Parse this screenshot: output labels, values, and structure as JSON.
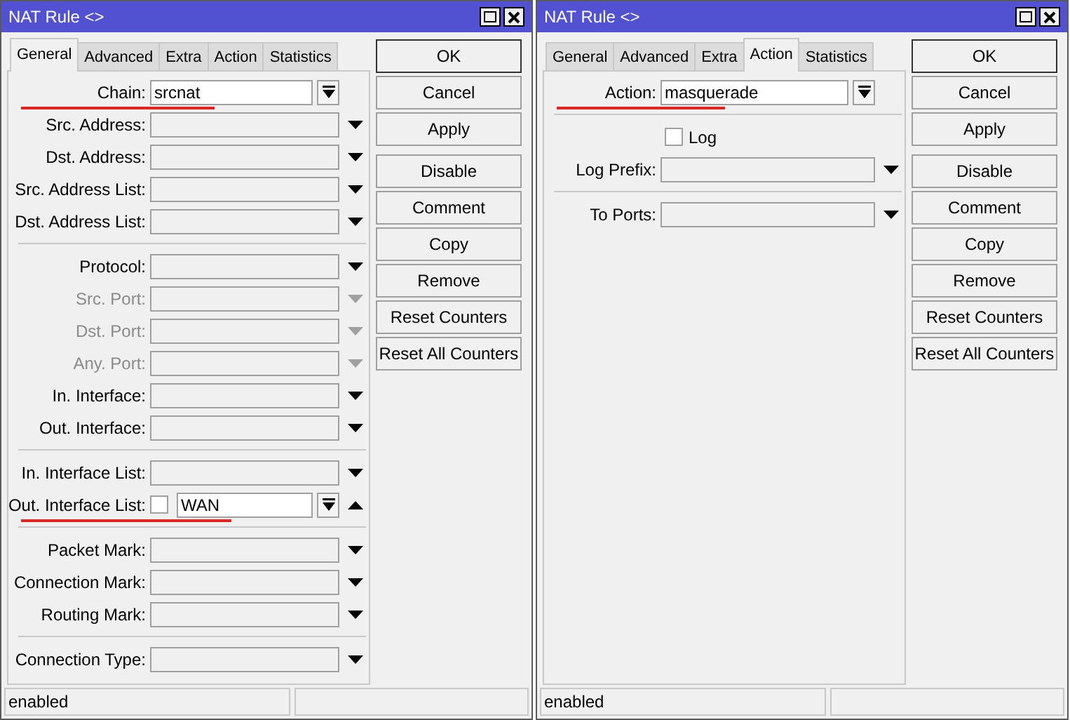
{
  "windows": [
    {
      "title": "NAT Rule <>",
      "tabs": [
        {
          "label": "General",
          "selected": true
        },
        {
          "label": "Advanced",
          "selected": false
        },
        {
          "label": "Extra",
          "selected": false
        },
        {
          "label": "Action",
          "selected": false
        },
        {
          "label": "Statistics",
          "selected": false
        }
      ],
      "sections": [
        {
          "rows": [
            {
              "kind": "combo",
              "label": "Chain:",
              "value": "srcnat",
              "highlighted": true
            },
            {
              "kind": "dropdown",
              "label": "Src. Address:",
              "disabled": false
            },
            {
              "kind": "dropdown",
              "label": "Dst. Address:",
              "disabled": false
            },
            {
              "kind": "dropdown",
              "label": "Src. Address List:",
              "disabled": false
            },
            {
              "kind": "dropdown",
              "label": "Dst. Address List:",
              "disabled": false
            }
          ]
        },
        {
          "rows": [
            {
              "kind": "dropdown",
              "label": "Protocol:",
              "disabled": false
            },
            {
              "kind": "dropdown",
              "label": "Src. Port:",
              "disabled": true
            },
            {
              "kind": "dropdown",
              "label": "Dst. Port:",
              "disabled": true
            },
            {
              "kind": "dropdown",
              "label": "Any. Port:",
              "disabled": true
            },
            {
              "kind": "dropdown",
              "label": "In. Interface:",
              "disabled": false
            },
            {
              "kind": "dropdown",
              "label": "Out. Interface:",
              "disabled": false
            }
          ]
        },
        {
          "rows": [
            {
              "kind": "dropdown",
              "label": "In. Interface List:",
              "disabled": false
            },
            {
              "kind": "negate-combo",
              "label": "Out. Interface List:",
              "value": "WAN",
              "checked": false,
              "highlighted": true
            }
          ]
        },
        {
          "rows": [
            {
              "kind": "dropdown",
              "label": "Packet Mark:",
              "disabled": false
            },
            {
              "kind": "dropdown",
              "label": "Connection Mark:",
              "disabled": false
            },
            {
              "kind": "dropdown",
              "label": "Routing Mark:",
              "disabled": false
            }
          ]
        },
        {
          "rows": [
            {
              "kind": "dropdown",
              "label": "Connection Type:",
              "disabled": false
            }
          ]
        }
      ],
      "button_groups": [
        [
          {
            "label": "OK",
            "default": true
          },
          {
            "label": "Cancel",
            "default": false
          },
          {
            "label": "Apply",
            "default": false
          }
        ],
        [
          {
            "label": "Disable",
            "default": false
          },
          {
            "label": "Comment",
            "default": false
          },
          {
            "label": "Copy",
            "default": false
          },
          {
            "label": "Remove",
            "default": false
          },
          {
            "label": "Reset Counters",
            "default": false
          },
          {
            "label": "Reset All Counters",
            "default": false
          }
        ]
      ],
      "status_bar": [
        "enabled"
      ]
    },
    {
      "title": "NAT Rule <>",
      "tabs": [
        {
          "label": "General",
          "selected": false
        },
        {
          "label": "Advanced",
          "selected": false
        },
        {
          "label": "Extra",
          "selected": false
        },
        {
          "label": "Action",
          "selected": true
        },
        {
          "label": "Statistics",
          "selected": false
        }
      ],
      "sections": [
        {
          "rows": [
            {
              "kind": "combo",
              "label": "Action:",
              "value": "masquerade",
              "highlighted": true
            }
          ]
        },
        {
          "rows": [
            {
              "kind": "checkbox",
              "label": "Log",
              "checked": false
            },
            {
              "kind": "dropdown",
              "label": "Log Prefix:",
              "disabled": false
            }
          ]
        },
        {
          "rows": [
            {
              "kind": "dropdown",
              "label": "To Ports:",
              "disabled": false
            }
          ]
        }
      ],
      "button_groups": [
        [
          {
            "label": "OK",
            "default": true
          },
          {
            "label": "Cancel",
            "default": false
          },
          {
            "label": "Apply",
            "default": false
          }
        ],
        [
          {
            "label": "Disable",
            "default": false
          },
          {
            "label": "Comment",
            "default": false
          },
          {
            "label": "Copy",
            "default": false
          },
          {
            "label": "Remove",
            "default": false
          },
          {
            "label": "Reset Counters",
            "default": false
          },
          {
            "label": "Reset All Counters",
            "default": false
          }
        ]
      ],
      "status_bar": [
        "enabled"
      ]
    }
  ]
}
